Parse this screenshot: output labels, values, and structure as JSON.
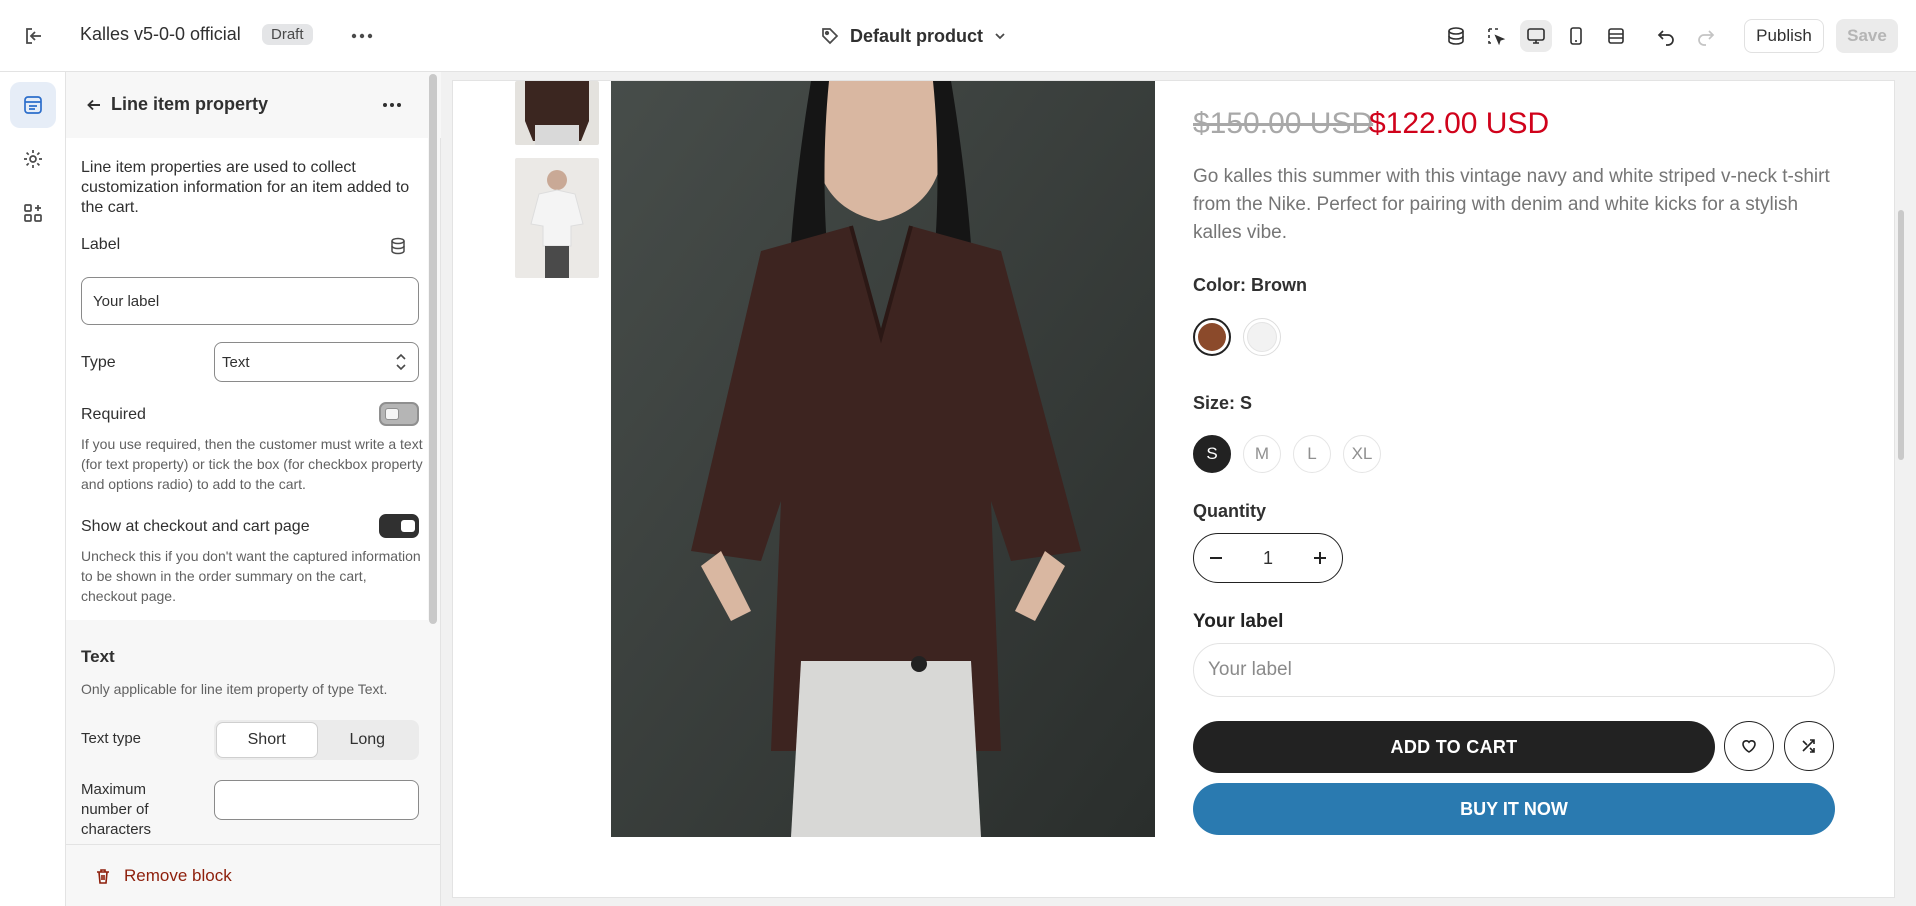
{
  "topbar": {
    "store_name": "Kalles v5-0-0 official",
    "status_badge": "Draft",
    "template_label": "Default product",
    "publish_label": "Publish",
    "save_label": "Save"
  },
  "panel": {
    "title": "Line item property",
    "description": "Line item properties are used to collect customization information for an item added to the cart.",
    "label_field": {
      "label": "Label",
      "value": "Your label"
    },
    "type_field": {
      "label": "Type",
      "value": "Text"
    },
    "required": {
      "label": "Required",
      "on": false,
      "help": "If you use required, then the customer must write a text (for text property) or tick the box (for checkbox property and options radio) to add to the cart."
    },
    "show_checkout": {
      "label": "Show at checkout and cart page",
      "on": true,
      "help": "Uncheck this if you don't want the captured information to be shown in the order summary on the cart, checkout page."
    },
    "text_section": {
      "heading": "Text",
      "help": "Only applicable for line item property of type Text.",
      "text_type_label": "Text type",
      "text_type_options": [
        "Short",
        "Long"
      ],
      "text_type_selected": "Short",
      "max_chars_label": "Maximum number of characters",
      "max_chars_value": ""
    },
    "remove_label": "Remove block"
  },
  "product": {
    "compare_price": "$150.00 USD",
    "price": "$122.00 USD",
    "description": "Go kalles this summer with this vintage navy and white striped v-neck t-shirt from the Nike. Perfect for pairing with denim and white kicks for a stylish kalles vibe.",
    "color_label": "Color: Brown",
    "colors": [
      "#8b4a2b",
      "#f2f2f2"
    ],
    "size_label": "Size: S",
    "sizes": [
      "S",
      "M",
      "L",
      "XL"
    ],
    "size_selected": "S",
    "quantity_label": "Quantity",
    "quantity": "1",
    "property_title": "Your label",
    "property_placeholder": "Your label",
    "add_to_cart": "ADD TO CART",
    "buy_now": "BUY IT NOW"
  }
}
